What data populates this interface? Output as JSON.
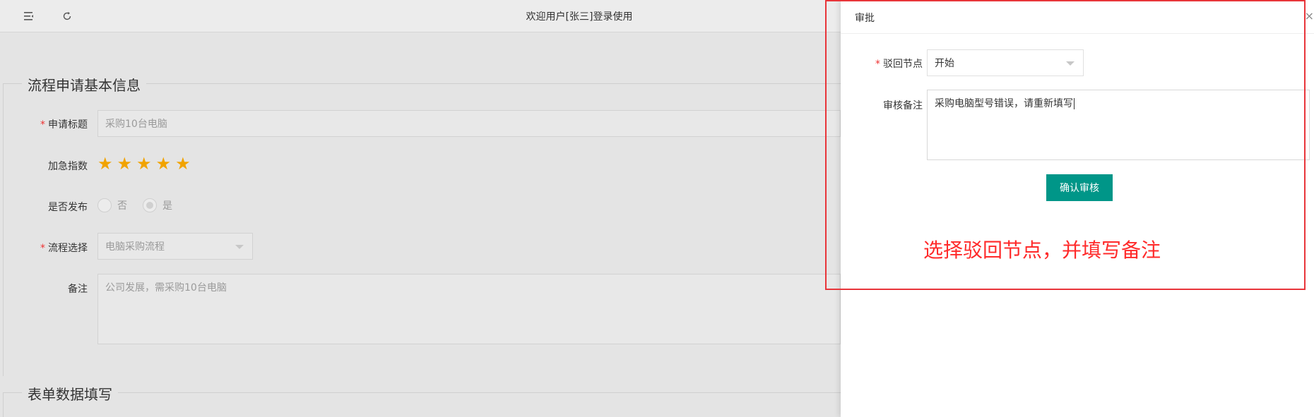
{
  "header": {
    "title": "欢迎用户[张三]登录使用",
    "menu_icon": "menu-toggle-icon",
    "refresh_icon": "refresh-icon"
  },
  "form": {
    "section1_title": "流程申请基本信息",
    "section2_title": "表单数据填写",
    "fields": {
      "title_label": "申请标题",
      "title_value": "采购10台电脑",
      "urgency_label": "加急指数",
      "urgency_stars": 5,
      "publish_label": "是否发布",
      "publish_options": [
        "否",
        "是"
      ],
      "publish_selected": "是",
      "process_label": "流程选择",
      "process_value": "电脑采购流程",
      "remark_label": "备注",
      "remark_value": "公司发展，需采购10台电脑"
    }
  },
  "panel": {
    "title": "审批",
    "close": "×",
    "reject_node_label": "驳回节点",
    "reject_node_value": "开始",
    "review_remark_label": "审核备注",
    "review_remark_value": "采购电脑型号错误，请重新填写",
    "confirm_button": "确认审核",
    "annotation": "选择驳回节点，并填写备注"
  },
  "colors": {
    "primary": "#009688",
    "star": "#f1a300",
    "annotation": "#ff2a2a",
    "required": "#e33"
  }
}
